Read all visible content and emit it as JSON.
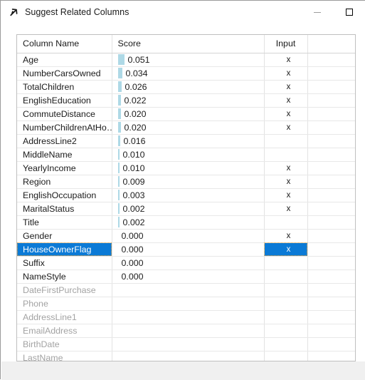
{
  "window": {
    "title": "Suggest Related Columns",
    "icon": "diagonal-arrow-icon",
    "minimize_label": "—",
    "maximize_label": "□"
  },
  "grid": {
    "columns": [
      "Column Name",
      "Score",
      "Input",
      ""
    ],
    "selected_row": "HouseOwnerFlag",
    "bar_color": "#aed9e6",
    "selection_color": "#0b7ad6",
    "max_score": 0.051,
    "rows": [
      {
        "name": "Age",
        "score": "0.051",
        "value": 0.051,
        "input": "x",
        "dimmed": false,
        "selected": false
      },
      {
        "name": "NumberCarsOwned",
        "score": "0.034",
        "value": 0.034,
        "input": "x",
        "dimmed": false,
        "selected": false
      },
      {
        "name": "TotalChildren",
        "score": "0.026",
        "value": 0.026,
        "input": "x",
        "dimmed": false,
        "selected": false
      },
      {
        "name": "EnglishEducation",
        "score": "0.022",
        "value": 0.022,
        "input": "x",
        "dimmed": false,
        "selected": false
      },
      {
        "name": "CommuteDistance",
        "score": "0.020",
        "value": 0.02,
        "input": "x",
        "dimmed": false,
        "selected": false
      },
      {
        "name": "NumberChildrenAtHo…",
        "score": "0.020",
        "value": 0.02,
        "input": "x",
        "dimmed": false,
        "selected": false
      },
      {
        "name": "AddressLine2",
        "score": "0.016",
        "value": 0.016,
        "input": "",
        "dimmed": false,
        "selected": false
      },
      {
        "name": "MiddleName",
        "score": "0.010",
        "value": 0.01,
        "input": "",
        "dimmed": false,
        "selected": false
      },
      {
        "name": "YearlyIncome",
        "score": "0.010",
        "value": 0.01,
        "input": "x",
        "dimmed": false,
        "selected": false
      },
      {
        "name": "Region",
        "score": "0.009",
        "value": 0.009,
        "input": "x",
        "dimmed": false,
        "selected": false
      },
      {
        "name": "EnglishOccupation",
        "score": "0.003",
        "value": 0.003,
        "input": "x",
        "dimmed": false,
        "selected": false
      },
      {
        "name": "MaritalStatus",
        "score": "0.002",
        "value": 0.002,
        "input": "x",
        "dimmed": false,
        "selected": false
      },
      {
        "name": "Title",
        "score": "0.002",
        "value": 0.002,
        "input": "",
        "dimmed": false,
        "selected": false
      },
      {
        "name": "Gender",
        "score": "0.000",
        "value": 0.0,
        "input": "x",
        "dimmed": false,
        "selected": false
      },
      {
        "name": "HouseOwnerFlag",
        "score": "0.000",
        "value": 0.0,
        "input": "x",
        "dimmed": false,
        "selected": true
      },
      {
        "name": "Suffix",
        "score": "0.000",
        "value": 0.0,
        "input": "",
        "dimmed": false,
        "selected": false
      },
      {
        "name": "NameStyle",
        "score": "0.000",
        "value": 0.0,
        "input": "",
        "dimmed": false,
        "selected": false
      },
      {
        "name": "DateFirstPurchase",
        "score": "",
        "value": null,
        "input": "",
        "dimmed": true,
        "selected": false
      },
      {
        "name": "Phone",
        "score": "",
        "value": null,
        "input": "",
        "dimmed": true,
        "selected": false
      },
      {
        "name": "AddressLine1",
        "score": "",
        "value": null,
        "input": "",
        "dimmed": true,
        "selected": false
      },
      {
        "name": "EmailAddress",
        "score": "",
        "value": null,
        "input": "",
        "dimmed": true,
        "selected": false
      },
      {
        "name": "BirthDate",
        "score": "",
        "value": null,
        "input": "",
        "dimmed": true,
        "selected": false
      },
      {
        "name": "LastName",
        "score": "",
        "value": null,
        "input": "",
        "dimmed": true,
        "selected": false
      }
    ]
  }
}
